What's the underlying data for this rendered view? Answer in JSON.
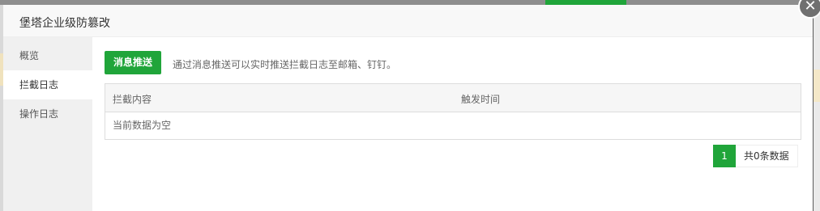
{
  "dialog": {
    "title": "堡塔企业级防篡改",
    "close_glyph": "✕"
  },
  "sidebar": {
    "items": [
      {
        "label": "概览",
        "active": false
      },
      {
        "label": "拦截日志",
        "active": true
      },
      {
        "label": "操作日志",
        "active": false
      }
    ]
  },
  "main": {
    "push_button_label": "消息推送",
    "push_description": "通过消息推送可以实时推送拦截日志至邮箱、钉钉。",
    "table": {
      "columns": [
        "拦截内容",
        "触发时间"
      ],
      "empty_text": "当前数据为空"
    },
    "pagination": {
      "current_page": "1",
      "total_text": "共0条数据"
    }
  },
  "colors": {
    "accent": "#20a53a",
    "sidebar_bg": "#f0f0f0",
    "header_bg": "#f8f8f8"
  }
}
